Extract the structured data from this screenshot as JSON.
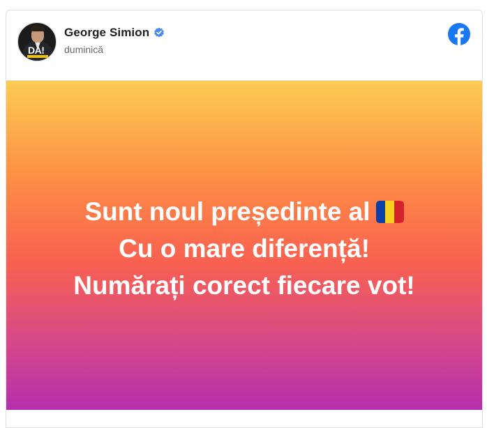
{
  "post": {
    "author": "George Simion",
    "timestamp": "duminică",
    "avatar_label": "DA!",
    "lines": [
      "Sunt noul președinte al",
      "Cu o mare diferență!",
      "Numărați corect fiecare vot!"
    ],
    "flag_emoji": "romania-flag",
    "icons": {
      "verified": "verified-badge-icon",
      "platform": "facebook-logo-icon"
    },
    "colors": {
      "verified": "#4a8cf7",
      "facebook": "#1877f2",
      "flag": [
        "#0b3fa8",
        "#f6d21f",
        "#d5232d"
      ],
      "gradient_top": "#fdcb52",
      "gradient_bottom": "#b42fad"
    }
  }
}
